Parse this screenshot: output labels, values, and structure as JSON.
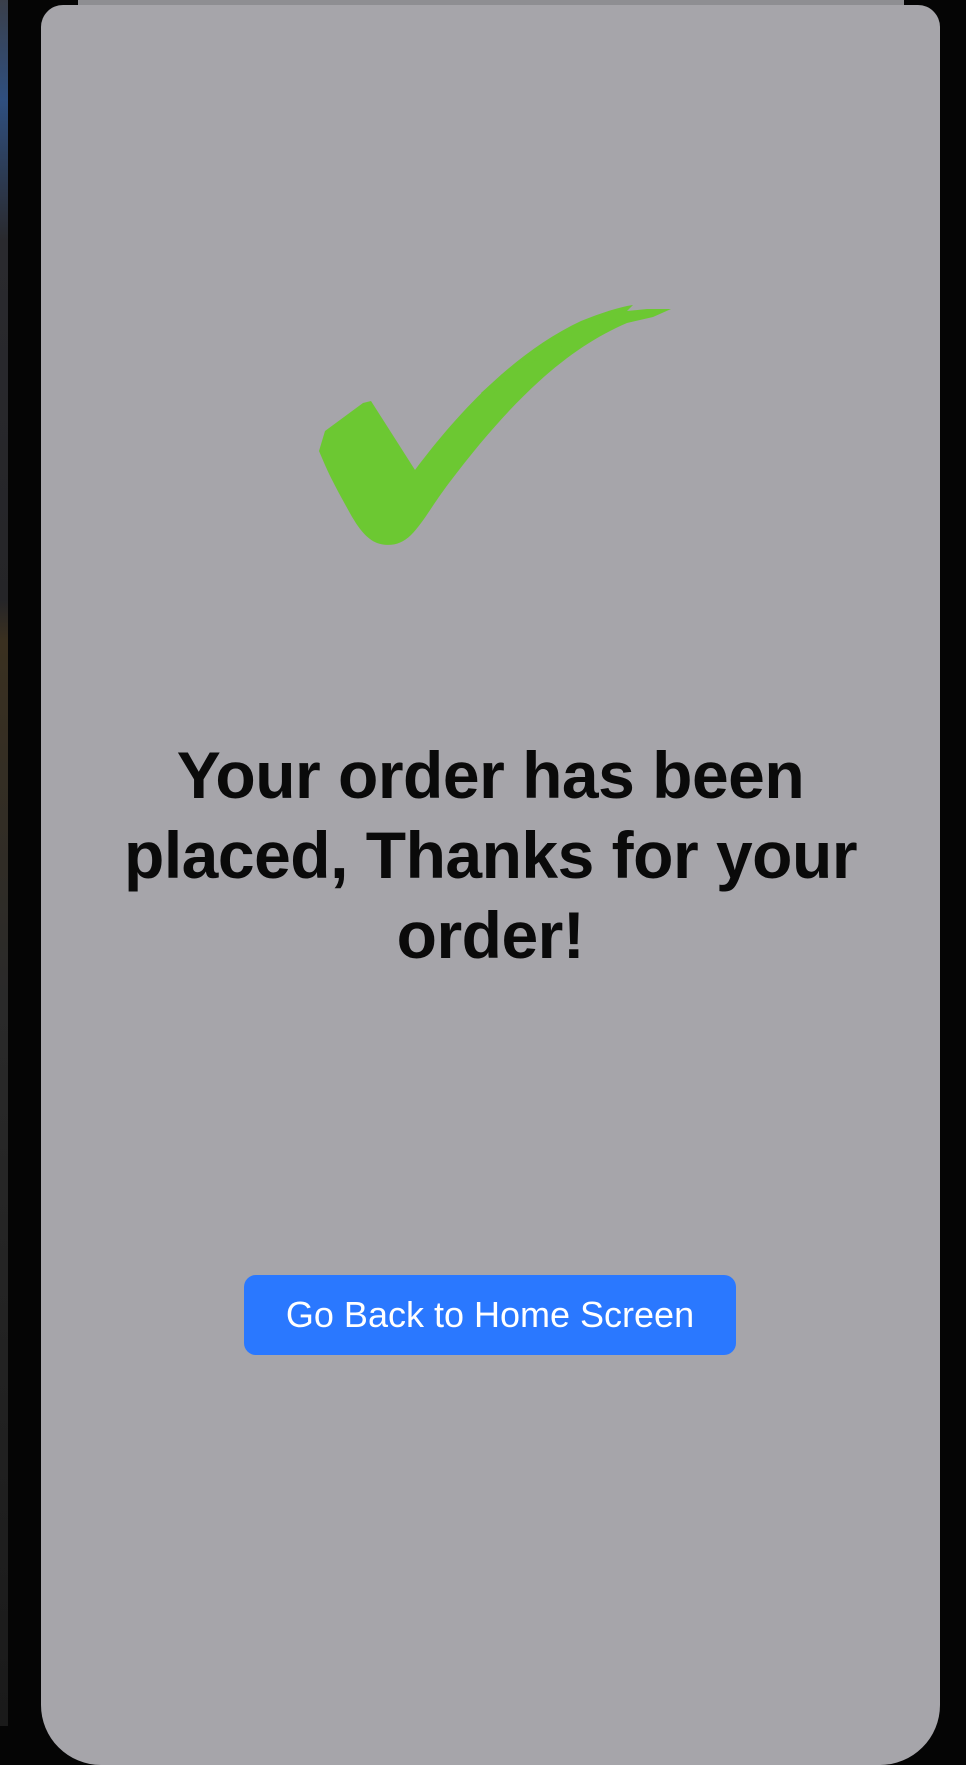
{
  "confirmation": {
    "icon": "checkmark-icon",
    "message": "Your order has been placed, Thanks for your order!"
  },
  "actions": {
    "home_button_label": "Go Back to Home Screen"
  },
  "colors": {
    "background": "#a6a5aa",
    "checkmark": "#6cc832",
    "button": "#2a78ff",
    "button_text": "#ffffff",
    "message_text": "#0a0a0a"
  }
}
